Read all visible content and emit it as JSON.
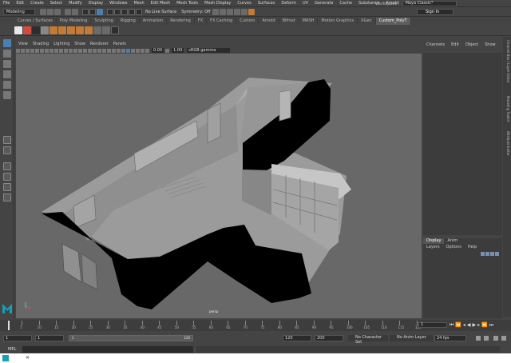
{
  "menu": {
    "items": [
      "File",
      "Edit",
      "Create",
      "Select",
      "Modify",
      "Display",
      "Windows",
      "Mesh",
      "Edit Mesh",
      "Mesh Tools",
      "Mesh Display",
      "Curves",
      "Surfaces",
      "Deform",
      "UV",
      "Generate",
      "Cache",
      "Substance",
      "Arnold",
      "Help"
    ],
    "workspace_label": "Workspace :",
    "workspace_value": "Maya Classic*"
  },
  "status": {
    "mode": "Modeling",
    "live_surface": "No Live Surface",
    "symmetry": "Symmetry: Off",
    "sign_in": "Sign In"
  },
  "shelf": {
    "tabs": [
      "Curves / Surfaces",
      "Poly Modeling",
      "Sculpting",
      "Rigging",
      "Animation",
      "Rendering",
      "FX",
      "FX Caching",
      "Custom",
      "Arnold",
      "Bifrost",
      "MASH",
      "Motion Graphics",
      "XGen",
      "Custom_PolyT"
    ],
    "active_tab": "Custom_PolyT"
  },
  "panel": {
    "menu": [
      "View",
      "Shading",
      "Lighting",
      "Show",
      "Renderer",
      "Panels"
    ],
    "exposure": "0.00",
    "gamma": "1.00",
    "color_space": "sRGB gamma",
    "camera_label": "persp"
  },
  "channel_box": {
    "menu": [
      "Channels",
      "Edit",
      "Object",
      "Show"
    ]
  },
  "side_tabs": [
    "Channel Box / Layer Editor",
    "Modeling Toolkit",
    "Attribute Editor"
  ],
  "layer_editor": {
    "tabs": [
      "Display",
      "Anim"
    ],
    "active_tab": "Display",
    "menu": [
      "Layers",
      "Options",
      "Help"
    ]
  },
  "timeline": {
    "ticks": [
      "5",
      "10",
      "15",
      "20",
      "25",
      "30",
      "35",
      "40",
      "45",
      "50",
      "55",
      "60",
      "65",
      "70",
      "75",
      "80",
      "85",
      "90",
      "95",
      "100",
      "105",
      "110",
      "115",
      "120"
    ],
    "current_frame": "1",
    "range_start": "1",
    "range_start_inner": "1",
    "range_bar_start": "1",
    "range_bar_end": "120",
    "range_end_inner": "120",
    "range_end": "200",
    "character_set": "No Character Set",
    "anim_layer": "No Anim Layer",
    "fps": "24 fps"
  },
  "command_line": {
    "label": "MEL"
  },
  "colors": {
    "accent": "#4a7fb0",
    "maya_logo": "#14a0b5"
  }
}
